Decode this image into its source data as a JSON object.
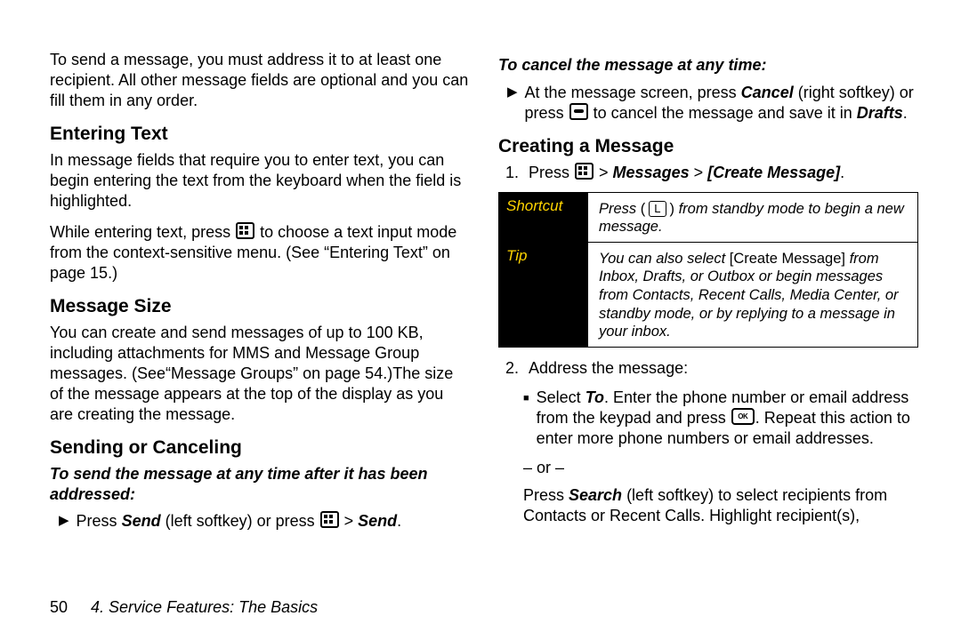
{
  "left": {
    "intro": "To send a message, you must address it to at least one recipient. All other message fields are optional and you can fill them in any order.",
    "h1": "Entering Text",
    "p1": "In message fields that require you to enter text, you can begin entering the text from the keyboard when the field is highlighted.",
    "p2a": "While entering text, press ",
    "p2b": " to choose a text input mode from the context-sensitive menu. (See “Entering Text” on page 15.)",
    "h2": "Message Size",
    "p3": "You can create and send messages of up to 100 KB, including attachments for MMS and Message Group messages. (See“Message Groups” on page 54.)The size of the message appears at the top of the display as you are creating the message.",
    "h3": "Sending or Canceling",
    "sub1": "To send the message at any time after it has been addressed:",
    "b1a": "Press ",
    "b1_send": "Send",
    "b1b": " (left softkey) or press ",
    "b1c": " > ",
    "b1d": "Send",
    "b1e": "."
  },
  "right": {
    "sub1": "To cancel the message at any time:",
    "c1a": "At the message screen, press ",
    "c1_cancel": "Cancel",
    "c1b": " (right softkey) or press ",
    "c1c": " to cancel the message and save it in ",
    "c1_drafts": "Drafts",
    "c1d": ".",
    "h1": "Creating a Message",
    "n1a": "Press ",
    "n1b": " > ",
    "n1c": "Messages",
    "n1d": " > ",
    "n1e": "[Create Message]",
    "n1f": ".",
    "box": {
      "shortcut_label": "Shortcut",
      "shortcut_a": "Press ",
      "shortcut_key": "L",
      "shortcut_b": " from standby mode to begin a new message.",
      "tip_label": "Tip",
      "tip_a": "You can also select ",
      "tip_cm": "[Create Message]",
      "tip_b": " from Inbox, Drafts, or Outbox or begin messages from Contacts, Recent Calls, Media Center, or standby mode, or by replying to a message in your inbox."
    },
    "n2": "Address the message:",
    "sq1a": "Select ",
    "sq1_to": "To",
    "sq1b": ". Enter the phone number or email address from the keypad and press ",
    "sq1c": ". Repeat this action to enter more phone numbers or email addresses.",
    "or": "– or –",
    "sq2a": "Press ",
    "sq2_search": "Search",
    "sq2b": " (left softkey) to select recipients from Contacts or Recent Calls. Highlight recipient(s),"
  },
  "footer": {
    "page": "50",
    "chapter": "4. Service Features: The Basics"
  }
}
